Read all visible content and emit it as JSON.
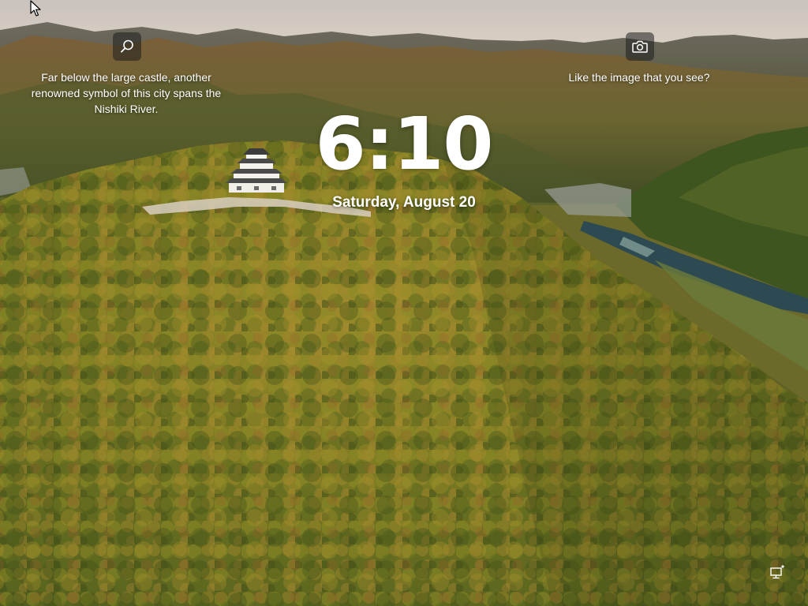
{
  "lock_screen": {
    "time": "6:10",
    "date": "Saturday, August 20"
  },
  "spotlight": {
    "info_text": "Far below the large castle, another renowned symbol of this city spans the Nishiki River.",
    "like_text": "Like the image that you see?",
    "info_icon": "search-icon",
    "like_icon": "camera-icon"
  },
  "status": {
    "network_icon": "network-monitor-icon"
  },
  "colors": {
    "sky": "#d8d0c6",
    "forest": "#6b6a22",
    "river": "#2d4a52",
    "overlay_button": "#1e1e1e",
    "text": "#ffffff"
  }
}
